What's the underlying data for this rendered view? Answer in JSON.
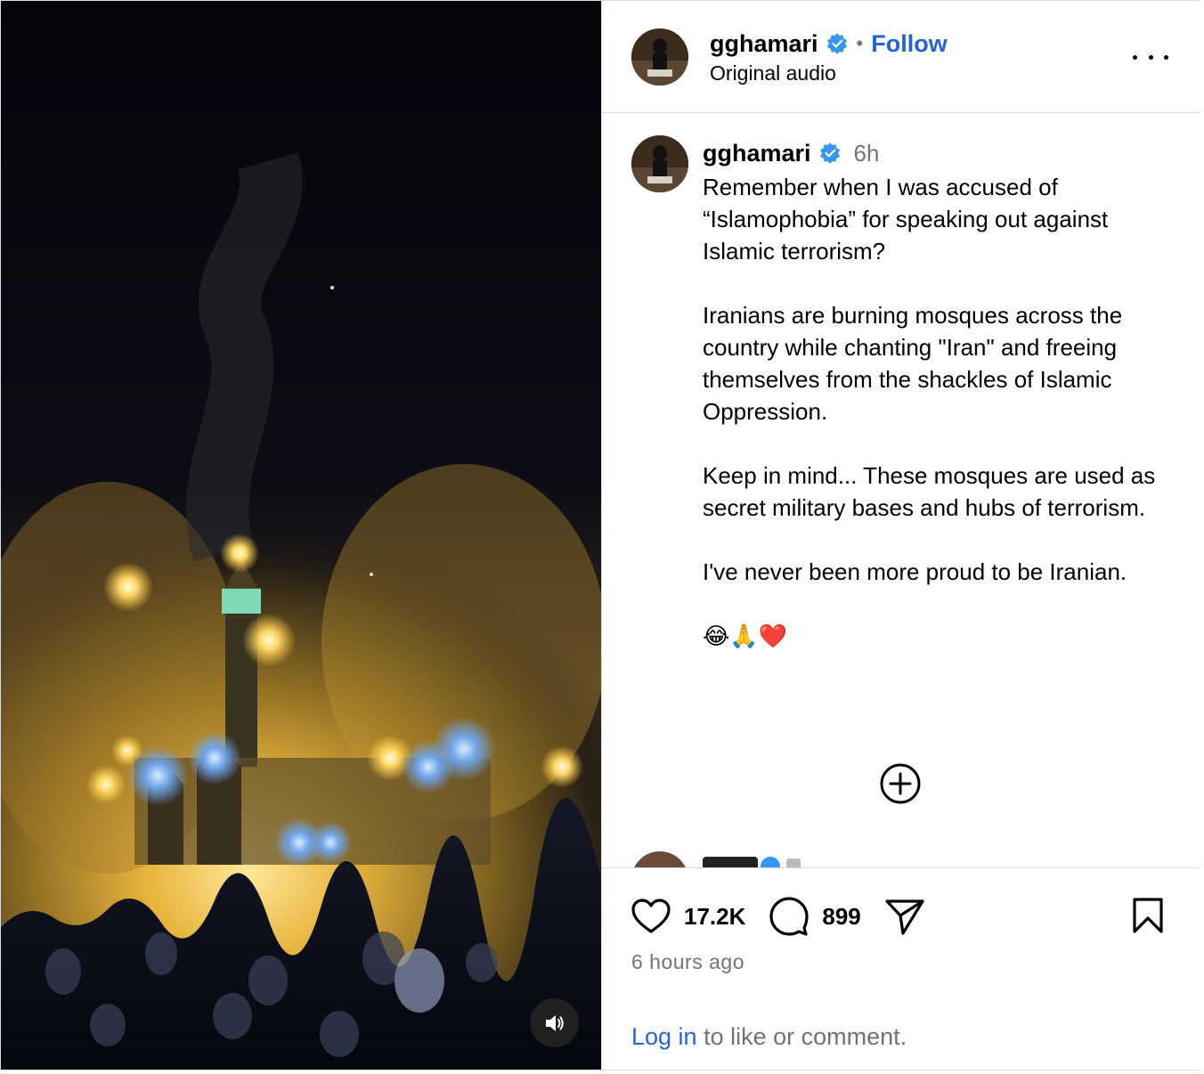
{
  "post": {
    "username": "gghamari",
    "follow_label": "Follow",
    "dot_separator": "•",
    "audio_label": "Original audio",
    "caption": {
      "username": "gghamari",
      "time_short": "6h",
      "text": "Remember when I was accused of “Islamophobia” for speaking out against Islamic terrorism?\n\nIranians are burning mosques across the country while chanting \"Iran\" and freeing themselves from the shackles of Islamic Oppression.\n\nKeep in mind... These mosques are used as secret military bases and hubs of terrorism.\n\nI've never been more proud to be Iranian.\n\n😂🙏❤️"
    }
  },
  "actions": {
    "likes": "17.2K",
    "comments": "899",
    "timestamp": "6 hours ago"
  },
  "login": {
    "link_label": "Log in",
    "suffix": " to like or comment."
  },
  "icons": {
    "verified": "verified-badge-icon",
    "more": "more-options-icon",
    "like": "heart-icon",
    "comment": "comment-bubble-icon",
    "share": "paper-plane-icon",
    "save": "bookmark-icon",
    "load_more": "plus-circle-icon",
    "volume": "speaker-icon"
  },
  "colors": {
    "accent_blue": "#2364d8",
    "verified_blue": "#3797f0",
    "muted_gray": "#737373",
    "divider": "#dbdbdb"
  }
}
